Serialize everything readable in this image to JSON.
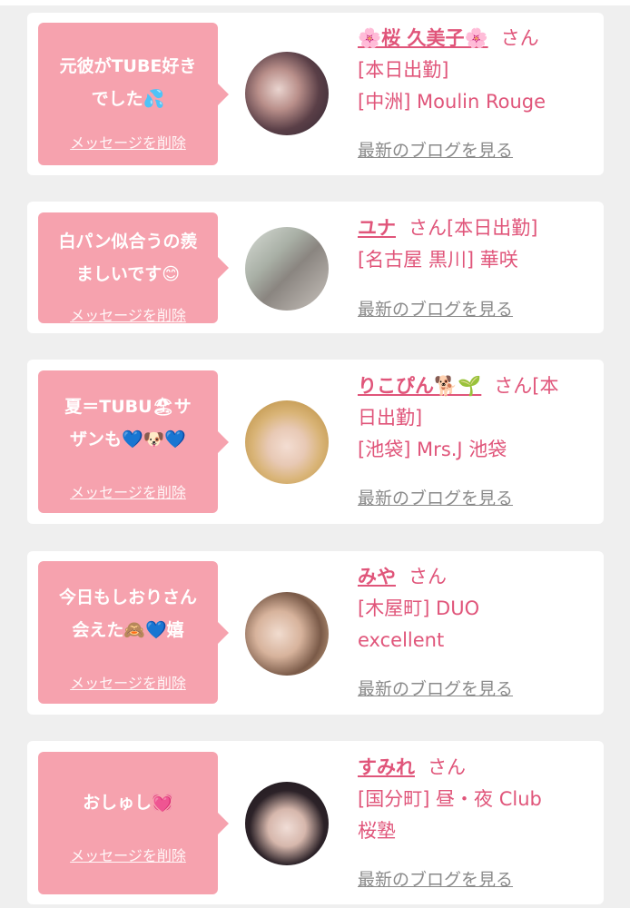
{
  "cards": [
    {
      "message_line1": "元彼がTUBE好き",
      "message_line2": "でした💦",
      "delete_label": "メッセージを削除",
      "name": "🌸桜 久美子🌸",
      "san": "さん",
      "info_line1": "[本日出勤]",
      "info_line2": "[中洲] Moulin Rouge",
      "blog_label": "最新のブログを見る"
    },
    {
      "message_line1": "白パン似合うの羨",
      "message_line2": "ましいです😊",
      "delete_label": "メッセージを削除",
      "name": "ユナ",
      "san": "さん[本日出勤]",
      "info_line1": "[名古屋 黒川] 華咲",
      "blog_label": "最新のブログを見る"
    },
    {
      "message_line1": "夏＝TUBU🏖サ",
      "message_line2": "ザンも💙🐶💙",
      "delete_label": "メッセージを削除",
      "name": "りこぴん🐕🌱",
      "san": "さん[本",
      "info_line1": "日出勤]",
      "info_line2": "[池袋] Mrs.J 池袋",
      "blog_label": "最新のブログを見る"
    },
    {
      "message_line1": "今日もしおりさん",
      "message_line2": "会えた🙈💙嬉",
      "delete_label": "メッセージを削除",
      "name": "みや",
      "san": "さん",
      "info_line1": "[木屋町] DUO",
      "info_line2": "excellent",
      "blog_label": "最新のブログを見る"
    },
    {
      "message_line1": "おしゅし💓",
      "delete_label": "メッセージを削除",
      "name": "すみれ",
      "san": "さん",
      "info_line1": "[国分町] 昼・夜 Club",
      "info_line2": "桜塾",
      "blog_label": "最新のブログを見る"
    }
  ],
  "colors": {
    "accent_pink": "#e0557a",
    "bubble_pink": "#f6a2ae",
    "page_background": "#efefef",
    "link_gray": "#8a8a8a"
  }
}
